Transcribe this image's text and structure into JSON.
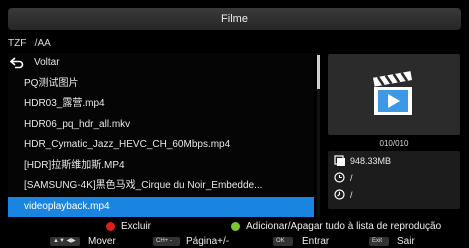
{
  "window": {
    "title": "Filme"
  },
  "path": {
    "device": "TZF",
    "folder": "/AA"
  },
  "file_list": {
    "back_label": "Voltar",
    "items": [
      "PQ测试图片",
      "HDR03_露营.mp4",
      "HDR06_pq_hdr_all.mkv",
      "HDR_Cymatic_Jazz_HEVC_CH_60Mbps.mp4",
      "[HDR]拉斯维加斯.MP4",
      "[SAMSUNG-4K]黑色马戏_Cirque du Noir_Embedde...",
      "videoplayback.mp4"
    ],
    "selected_index": 6
  },
  "details": {
    "counter": "010/010",
    "file_size": "948.33MB",
    "duration": "/",
    "date": "/"
  },
  "color_keys": {
    "red": {
      "label": "Excluir",
      "color": "#e01b1b"
    },
    "green": {
      "label": "Adicionar/Apagar tudo à lista de reprodução",
      "color": "#7bc62d"
    }
  },
  "nav_keys": {
    "move": {
      "key": "▲▼ ◀▶",
      "label": "Mover"
    },
    "page": {
      "key": "CH+ -",
      "label": "Página+/-"
    },
    "enter": {
      "key": "OK",
      "label": "Entrar"
    },
    "exit": {
      "key": "Exit",
      "label": "Sair"
    }
  },
  "colors": {
    "accent": "#1a85e0",
    "panel": "#2b2b2b"
  }
}
